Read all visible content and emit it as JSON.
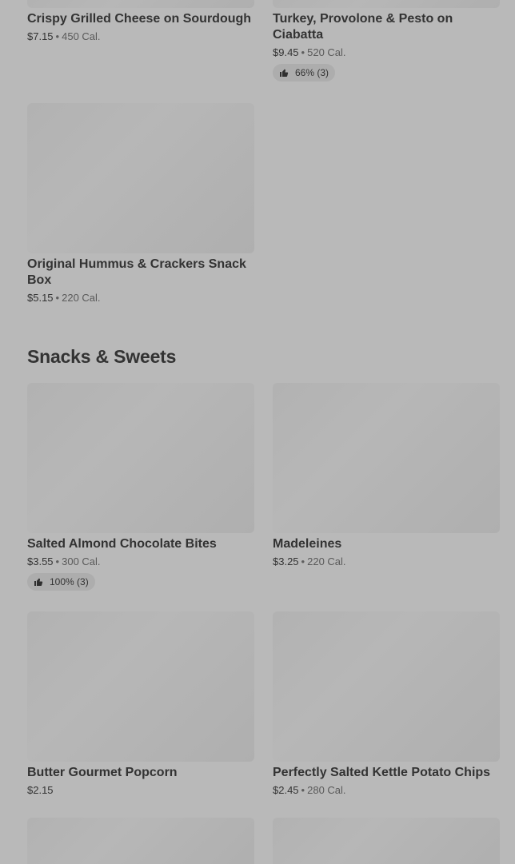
{
  "items_top": [
    {
      "name": "Crispy Grilled Cheese on Sourdough",
      "price": "$7.15",
      "calories": "450 Cal."
    },
    {
      "name": "Turkey, Provolone & Pesto on Ciabatta",
      "price": "$9.45",
      "calories": "520 Cal.",
      "rating": "66% (3)"
    },
    {
      "name": "Original Hummus & Crackers Snack Box",
      "price": "$5.15",
      "calories": "220 Cal."
    }
  ],
  "section": {
    "title": "Snacks & Sweets"
  },
  "items_snacks": [
    {
      "name": "Salted Almond Chocolate Bites",
      "price": "$3.55",
      "calories": "300 Cal.",
      "rating": "100% (3)"
    },
    {
      "name": "Madeleines",
      "price": "$3.25",
      "calories": "220 Cal."
    },
    {
      "name": "Butter Gourmet Popcorn",
      "price": "$2.15"
    },
    {
      "name": "Perfectly Salted Kettle Potato Chips",
      "price": "$2.45",
      "calories": "280 Cal."
    }
  ],
  "separator": "•",
  "icons": {
    "rating": "thumbs-up-icon"
  }
}
